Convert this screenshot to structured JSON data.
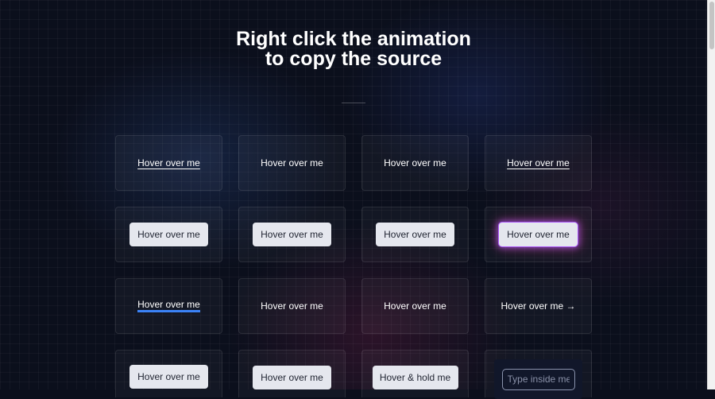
{
  "heading": {
    "line1": "Right click the animation",
    "line2": "to copy the source"
  },
  "rows": [
    [
      "Hover over me",
      "Hover over me",
      "Hover over me",
      "Hover over me"
    ],
    [
      "Hover over me",
      "Hover over me",
      "Hover over me",
      "Hover over me"
    ],
    [
      "Hover over me",
      "Hover over me",
      "Hover over me",
      "Hover over me →"
    ],
    [
      "Hover over me",
      "Hover over me",
      "Hover & hold me"
    ]
  ],
  "input": {
    "placeholder": "Type inside me"
  },
  "colors": {
    "background": "#0b0f1c",
    "button": "#e5e7ee",
    "underline_accent": "#3b82f6",
    "glow_accent": "#a855f7"
  }
}
